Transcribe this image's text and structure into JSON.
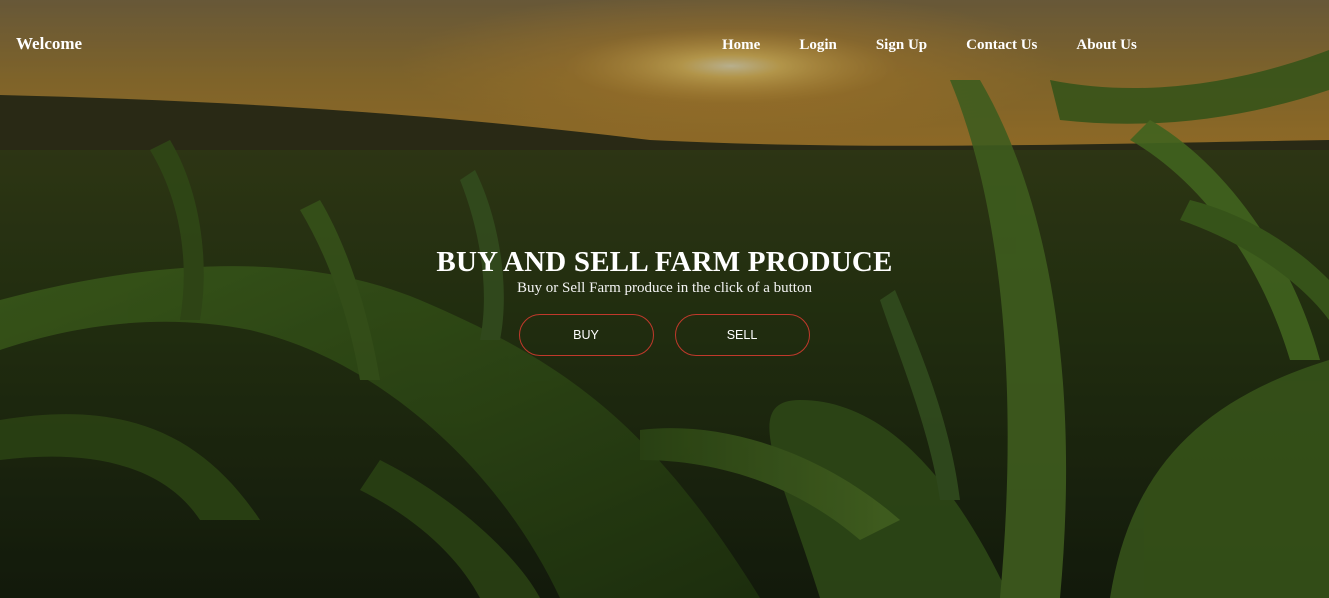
{
  "navbar": {
    "brand": "Welcome",
    "links": [
      {
        "label": "Home"
      },
      {
        "label": "Login"
      },
      {
        "label": "Sign Up"
      },
      {
        "label": "Contact Us"
      },
      {
        "label": "About Us"
      }
    ]
  },
  "hero": {
    "title": "BUY AND SELL FARM PRODUCE",
    "subtitle": "Buy or Sell Farm produce in the click of a button",
    "buttons": [
      {
        "label": "BUY"
      },
      {
        "label": "SELL"
      }
    ],
    "button_border_color": "#c0392b",
    "background_image": "cornfield-sunset"
  }
}
